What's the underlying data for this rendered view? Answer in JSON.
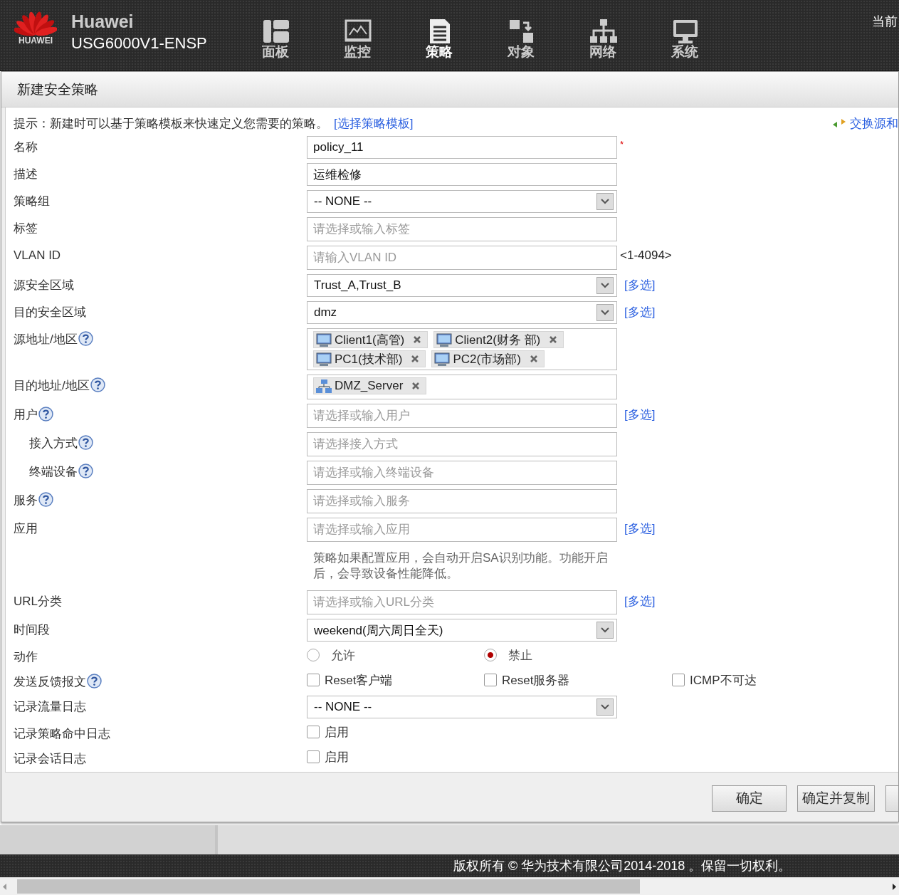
{
  "header": {
    "logo_text": "HUAWEI",
    "brand": "Huawei",
    "model": "USG6000V1-ENSP",
    "corner_text": "当前",
    "nav": [
      {
        "label": "面板",
        "kind": "panels",
        "selected": false
      },
      {
        "label": "监控",
        "kind": "monitor",
        "selected": false
      },
      {
        "label": "策略",
        "kind": "document",
        "selected": true
      },
      {
        "label": "对象",
        "kind": "objects",
        "selected": false
      },
      {
        "label": "网络",
        "kind": "network",
        "selected": false
      },
      {
        "label": "系统",
        "kind": "system",
        "selected": false
      }
    ]
  },
  "dialog": {
    "title": "新建安全策略",
    "hint": "提示：新建时可以基于策略模板来快速定义您需要的策略。",
    "hint_link": "[选择策略模板]",
    "swap_link": "交换源和",
    "rows": [
      {
        "kind": "text",
        "label": "名称",
        "help": false,
        "value": "policy_11",
        "required_mark": "*"
      },
      {
        "kind": "text",
        "label": "描述",
        "help": false,
        "value": "运维检修"
      },
      {
        "kind": "select",
        "label": "策略组",
        "help": false,
        "value": "-- NONE --"
      },
      {
        "kind": "text",
        "label": "标签",
        "help": false,
        "placeholder": "请选择或输入标签"
      },
      {
        "kind": "text",
        "label": "VLAN ID",
        "help": false,
        "placeholder": "请输入VLAN ID",
        "suffix": "<1-4094>"
      },
      {
        "kind": "select",
        "label": "源安全区域",
        "help": false,
        "value": "Trust_A,Trust_B",
        "multi": "[多选]"
      },
      {
        "kind": "select",
        "label": "目的安全区域",
        "help": false,
        "value": "dmz",
        "multi": "[多选]"
      },
      {
        "kind": "tags",
        "label": "源地址/地区",
        "help": true,
        "tags": [
          {
            "label": "Client1(高管)",
            "kind": "pc"
          },
          {
            "label": "Client2(财务 部)",
            "kind": "pc"
          },
          {
            "label": "PC1(技术部)",
            "kind": "pc"
          },
          {
            "label": "PC2(市场部)",
            "kind": "pc"
          }
        ]
      },
      {
        "kind": "tags",
        "label": "目的地址/地区",
        "help": true,
        "tags": [
          {
            "label": "DMZ_Server",
            "kind": "server"
          }
        ]
      },
      {
        "kind": "text",
        "label": "用户",
        "help": true,
        "placeholder": "请选择或输入用户",
        "multi": "[多选]",
        "children": [
          {
            "kind": "text",
            "label": "接入方式",
            "help": true,
            "placeholder": "请选择接入方式"
          },
          {
            "kind": "text",
            "label": "终端设备",
            "help": true,
            "placeholder": "请选择或输入终端设备"
          }
        ]
      },
      {
        "kind": "text",
        "label": "服务",
        "help": true,
        "placeholder": "请选择或输入服务"
      },
      {
        "kind": "text",
        "label": "应用",
        "help": false,
        "placeholder": "请选择或输入应用",
        "multi": "[多选]"
      },
      {
        "kind": "note",
        "text": "策略如果配置应用，会自动开启SA识别功能。功能开启后，会导致设备性能降低。"
      },
      {
        "kind": "text",
        "label": "URL分类",
        "help": false,
        "placeholder": "请选择或输入URL分类",
        "multi": "[多选]"
      },
      {
        "kind": "select",
        "label": "时间段",
        "help": false,
        "value": "weekend(周六周日全天)"
      },
      {
        "kind": "radio",
        "label": "动作",
        "help": false,
        "options": [
          {
            "label": "允许",
            "selected": false
          },
          {
            "label": "禁止",
            "selected": true
          }
        ]
      },
      {
        "kind": "checkbox",
        "label": "发送反馈报文",
        "help": true,
        "options": [
          {
            "label": "Reset客户端",
            "checked": false
          },
          {
            "label": "Reset服务器",
            "checked": false
          },
          {
            "label": "ICMP不可达",
            "checked": false
          }
        ]
      },
      {
        "kind": "select",
        "label": "记录流量日志",
        "help": false,
        "value": "-- NONE --"
      },
      {
        "kind": "checkbox",
        "label": "记录策略命中日志",
        "help": false,
        "options": [
          {
            "label": "启用",
            "checked": false
          }
        ]
      },
      {
        "kind": "checkbox",
        "label": "记录会话日志",
        "help": false,
        "options": [
          {
            "label": "启用",
            "checked": false
          }
        ]
      }
    ],
    "buttons": [
      "确定",
      "确定并复制"
    ]
  },
  "footer": "版权所有 © 华为技术有限公司2014-2018 。保留一切权利。"
}
